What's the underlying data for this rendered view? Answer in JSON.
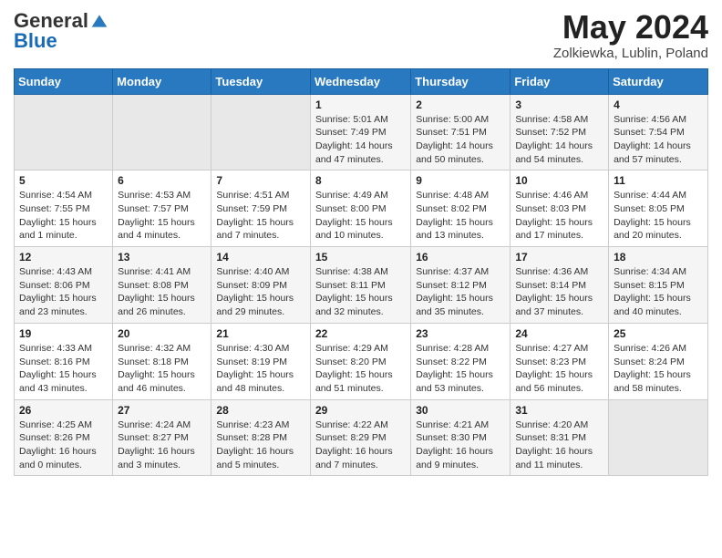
{
  "header": {
    "logo_general": "General",
    "logo_blue": "Blue",
    "month_title": "May 2024",
    "location": "Zolkiewka, Lublin, Poland"
  },
  "weekdays": [
    "Sunday",
    "Monday",
    "Tuesday",
    "Wednesday",
    "Thursday",
    "Friday",
    "Saturday"
  ],
  "weeks": [
    [
      {
        "day": "",
        "sunrise": "",
        "sunset": "",
        "daylight": ""
      },
      {
        "day": "",
        "sunrise": "",
        "sunset": "",
        "daylight": ""
      },
      {
        "day": "",
        "sunrise": "",
        "sunset": "",
        "daylight": ""
      },
      {
        "day": "1",
        "sunrise": "Sunrise: 5:01 AM",
        "sunset": "Sunset: 7:49 PM",
        "daylight": "Daylight: 14 hours and 47 minutes."
      },
      {
        "day": "2",
        "sunrise": "Sunrise: 5:00 AM",
        "sunset": "Sunset: 7:51 PM",
        "daylight": "Daylight: 14 hours and 50 minutes."
      },
      {
        "day": "3",
        "sunrise": "Sunrise: 4:58 AM",
        "sunset": "Sunset: 7:52 PM",
        "daylight": "Daylight: 14 hours and 54 minutes."
      },
      {
        "day": "4",
        "sunrise": "Sunrise: 4:56 AM",
        "sunset": "Sunset: 7:54 PM",
        "daylight": "Daylight: 14 hours and 57 minutes."
      }
    ],
    [
      {
        "day": "5",
        "sunrise": "Sunrise: 4:54 AM",
        "sunset": "Sunset: 7:55 PM",
        "daylight": "Daylight: 15 hours and 1 minute."
      },
      {
        "day": "6",
        "sunrise": "Sunrise: 4:53 AM",
        "sunset": "Sunset: 7:57 PM",
        "daylight": "Daylight: 15 hours and 4 minutes."
      },
      {
        "day": "7",
        "sunrise": "Sunrise: 4:51 AM",
        "sunset": "Sunset: 7:59 PM",
        "daylight": "Daylight: 15 hours and 7 minutes."
      },
      {
        "day": "8",
        "sunrise": "Sunrise: 4:49 AM",
        "sunset": "Sunset: 8:00 PM",
        "daylight": "Daylight: 15 hours and 10 minutes."
      },
      {
        "day": "9",
        "sunrise": "Sunrise: 4:48 AM",
        "sunset": "Sunset: 8:02 PM",
        "daylight": "Daylight: 15 hours and 13 minutes."
      },
      {
        "day": "10",
        "sunrise": "Sunrise: 4:46 AM",
        "sunset": "Sunset: 8:03 PM",
        "daylight": "Daylight: 15 hours and 17 minutes."
      },
      {
        "day": "11",
        "sunrise": "Sunrise: 4:44 AM",
        "sunset": "Sunset: 8:05 PM",
        "daylight": "Daylight: 15 hours and 20 minutes."
      }
    ],
    [
      {
        "day": "12",
        "sunrise": "Sunrise: 4:43 AM",
        "sunset": "Sunset: 8:06 PM",
        "daylight": "Daylight: 15 hours and 23 minutes."
      },
      {
        "day": "13",
        "sunrise": "Sunrise: 4:41 AM",
        "sunset": "Sunset: 8:08 PM",
        "daylight": "Daylight: 15 hours and 26 minutes."
      },
      {
        "day": "14",
        "sunrise": "Sunrise: 4:40 AM",
        "sunset": "Sunset: 8:09 PM",
        "daylight": "Daylight: 15 hours and 29 minutes."
      },
      {
        "day": "15",
        "sunrise": "Sunrise: 4:38 AM",
        "sunset": "Sunset: 8:11 PM",
        "daylight": "Daylight: 15 hours and 32 minutes."
      },
      {
        "day": "16",
        "sunrise": "Sunrise: 4:37 AM",
        "sunset": "Sunset: 8:12 PM",
        "daylight": "Daylight: 15 hours and 35 minutes."
      },
      {
        "day": "17",
        "sunrise": "Sunrise: 4:36 AM",
        "sunset": "Sunset: 8:14 PM",
        "daylight": "Daylight: 15 hours and 37 minutes."
      },
      {
        "day": "18",
        "sunrise": "Sunrise: 4:34 AM",
        "sunset": "Sunset: 8:15 PM",
        "daylight": "Daylight: 15 hours and 40 minutes."
      }
    ],
    [
      {
        "day": "19",
        "sunrise": "Sunrise: 4:33 AM",
        "sunset": "Sunset: 8:16 PM",
        "daylight": "Daylight: 15 hours and 43 minutes."
      },
      {
        "day": "20",
        "sunrise": "Sunrise: 4:32 AM",
        "sunset": "Sunset: 8:18 PM",
        "daylight": "Daylight: 15 hours and 46 minutes."
      },
      {
        "day": "21",
        "sunrise": "Sunrise: 4:30 AM",
        "sunset": "Sunset: 8:19 PM",
        "daylight": "Daylight: 15 hours and 48 minutes."
      },
      {
        "day": "22",
        "sunrise": "Sunrise: 4:29 AM",
        "sunset": "Sunset: 8:20 PM",
        "daylight": "Daylight: 15 hours and 51 minutes."
      },
      {
        "day": "23",
        "sunrise": "Sunrise: 4:28 AM",
        "sunset": "Sunset: 8:22 PM",
        "daylight": "Daylight: 15 hours and 53 minutes."
      },
      {
        "day": "24",
        "sunrise": "Sunrise: 4:27 AM",
        "sunset": "Sunset: 8:23 PM",
        "daylight": "Daylight: 15 hours and 56 minutes."
      },
      {
        "day": "25",
        "sunrise": "Sunrise: 4:26 AM",
        "sunset": "Sunset: 8:24 PM",
        "daylight": "Daylight: 15 hours and 58 minutes."
      }
    ],
    [
      {
        "day": "26",
        "sunrise": "Sunrise: 4:25 AM",
        "sunset": "Sunset: 8:26 PM",
        "daylight": "Daylight: 16 hours and 0 minutes."
      },
      {
        "day": "27",
        "sunrise": "Sunrise: 4:24 AM",
        "sunset": "Sunset: 8:27 PM",
        "daylight": "Daylight: 16 hours and 3 minutes."
      },
      {
        "day": "28",
        "sunrise": "Sunrise: 4:23 AM",
        "sunset": "Sunset: 8:28 PM",
        "daylight": "Daylight: 16 hours and 5 minutes."
      },
      {
        "day": "29",
        "sunrise": "Sunrise: 4:22 AM",
        "sunset": "Sunset: 8:29 PM",
        "daylight": "Daylight: 16 hours and 7 minutes."
      },
      {
        "day": "30",
        "sunrise": "Sunrise: 4:21 AM",
        "sunset": "Sunset: 8:30 PM",
        "daylight": "Daylight: 16 hours and 9 minutes."
      },
      {
        "day": "31",
        "sunrise": "Sunrise: 4:20 AM",
        "sunset": "Sunset: 8:31 PM",
        "daylight": "Daylight: 16 hours and 11 minutes."
      },
      {
        "day": "",
        "sunrise": "",
        "sunset": "",
        "daylight": ""
      }
    ]
  ]
}
